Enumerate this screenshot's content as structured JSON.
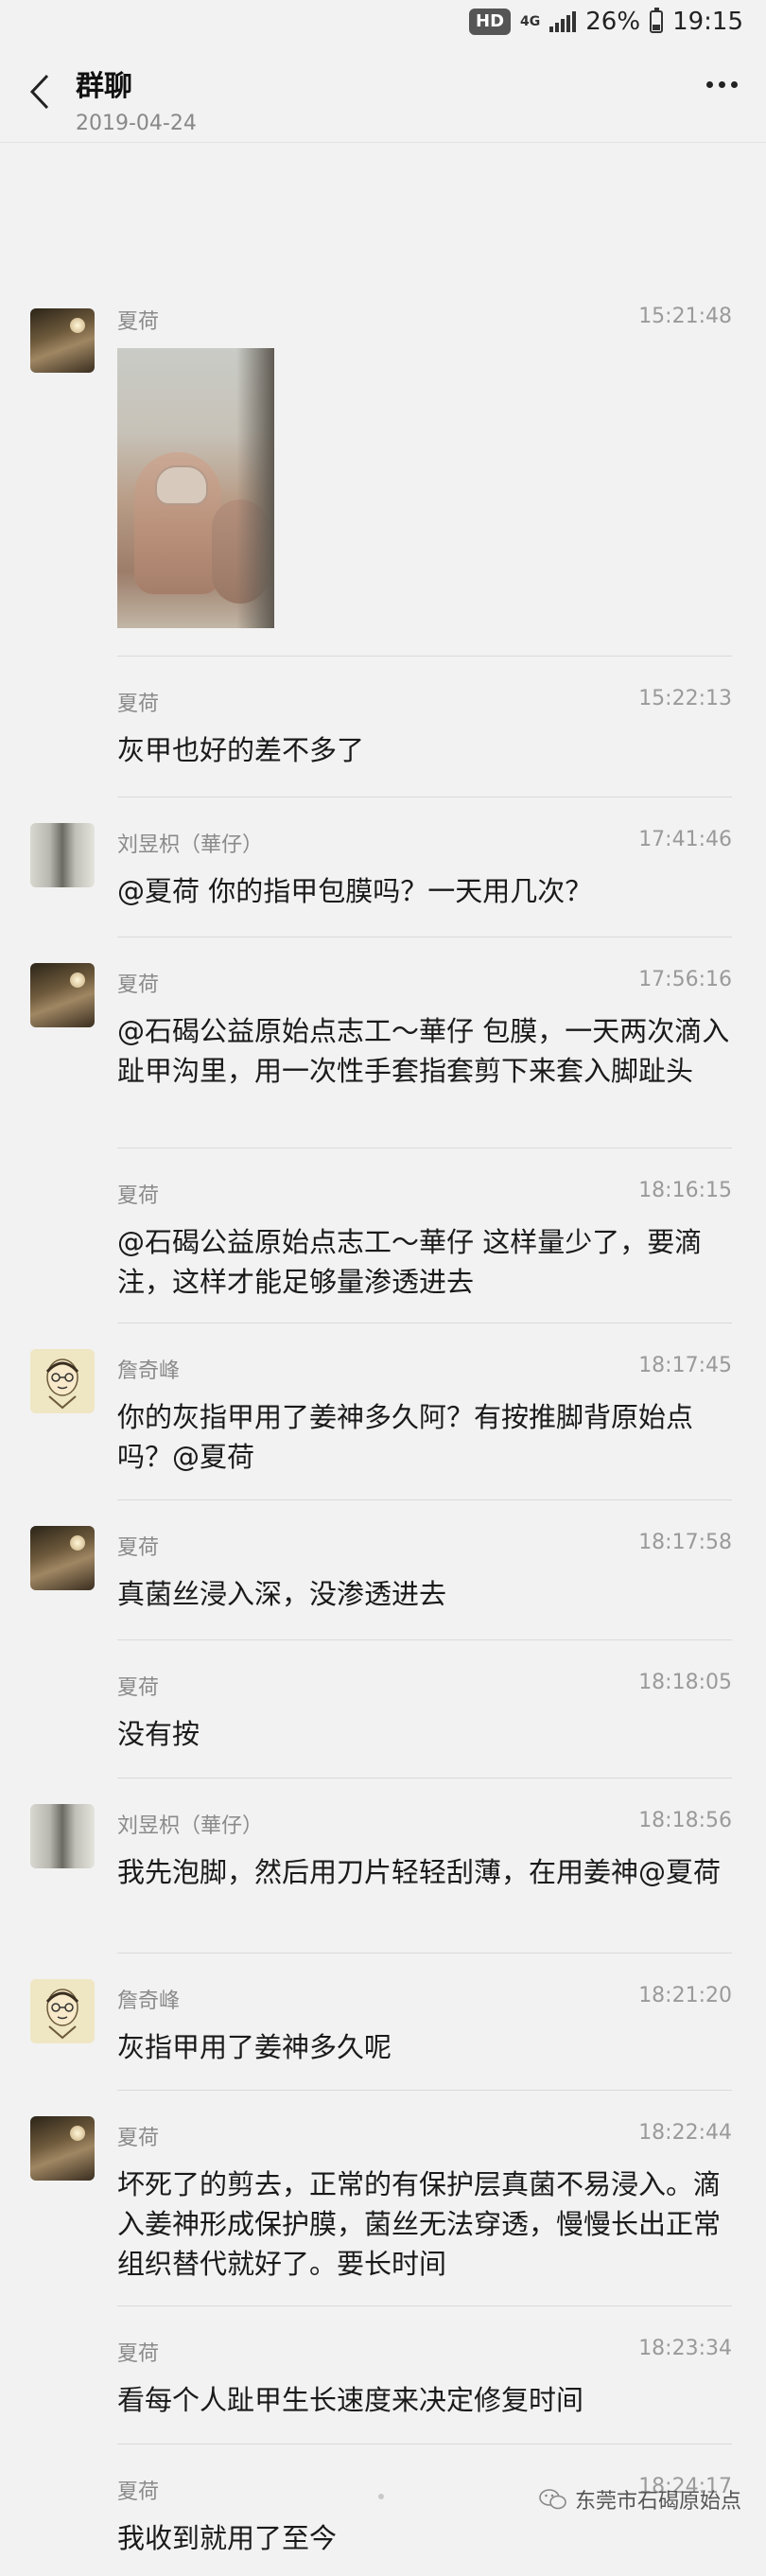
{
  "status_bar": {
    "hd": "HD",
    "network": "4G",
    "battery": "26%",
    "time": "19:15"
  },
  "header": {
    "title": "群聊",
    "date": "2019-04-24"
  },
  "messages": [
    {
      "sender": "夏荷",
      "time": "15:21:48",
      "text": "",
      "avatar": "xiahe",
      "has_image": true
    },
    {
      "sender": "夏荷",
      "time": "15:22:13",
      "text": "灰甲也好的差不多了",
      "avatar": ""
    },
    {
      "sender": "刘昱枳（華仔）",
      "time": "17:41:46",
      "text": "@夏荷 你的指甲包膜吗？一天用几次？",
      "avatar": "liu"
    },
    {
      "sender": "夏荷",
      "time": "17:56:16",
      "text": "@石碣公益原始点志工～華仔 包膜，一天两次滴入趾甲沟里，用一次性手套指套剪下来套入脚趾头",
      "avatar": "xiahe"
    },
    {
      "sender": "夏荷",
      "time": "18:16:15",
      "text": "@石碣公益原始点志工～華仔 这样量少了，要滴注，这样才能足够量渗透进去",
      "avatar": ""
    },
    {
      "sender": "詹奇峰",
      "time": "18:17:45",
      "text": "你的灰指甲用了姜神多久阿？有按推脚背原始点吗？@夏荷",
      "avatar": "zhan"
    },
    {
      "sender": "夏荷",
      "time": "18:17:58",
      "text": "真菌丝浸入深，没渗透进去",
      "avatar": "xiahe"
    },
    {
      "sender": "夏荷",
      "time": "18:18:05",
      "text": "没有按",
      "avatar": ""
    },
    {
      "sender": "刘昱枳（華仔）",
      "time": "18:18:56",
      "text": "我先泡脚，然后用刀片轻轻刮薄，在用姜神@夏荷",
      "avatar": "liu"
    },
    {
      "sender": "詹奇峰",
      "time": "18:21:20",
      "text": "灰指甲用了姜神多久呢",
      "avatar": "zhan"
    },
    {
      "sender": "夏荷",
      "time": "18:22:44",
      "text": "坏死了的剪去，正常的有保护层真菌不易浸入。滴入姜神形成保护膜，菌丝无法穿透，慢慢长出正常组织替代就好了。要长时间",
      "avatar": "xiahe"
    },
    {
      "sender": "夏荷",
      "time": "18:23:34",
      "text": "看每个人趾甲生长速度来决定修复时间",
      "avatar": ""
    },
    {
      "sender": "夏荷",
      "time": "18:24:17",
      "text": "我收到就用了至今",
      "avatar": ""
    }
  ],
  "watermark": "东莞市石碣原始点",
  "icons": {
    "back": "chevron-left-icon",
    "more": "more-dots-icon",
    "watermark": "wechat-icon"
  }
}
